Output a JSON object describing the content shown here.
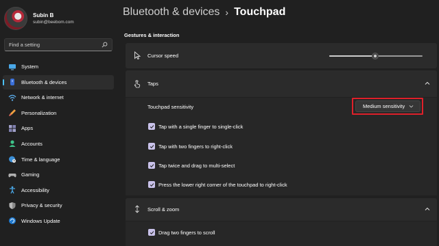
{
  "profile": {
    "name": "Subin B",
    "email": "subin@beebom.com"
  },
  "search": {
    "placeholder": "Find a setting"
  },
  "nav": {
    "items": [
      {
        "label": "System",
        "icon": "monitor-icon"
      },
      {
        "label": "Bluetooth & devices",
        "icon": "bluetooth-icon",
        "active": true
      },
      {
        "label": "Network & internet",
        "icon": "wifi-icon"
      },
      {
        "label": "Personalization",
        "icon": "brush-icon"
      },
      {
        "label": "Apps",
        "icon": "apps-icon"
      },
      {
        "label": "Accounts",
        "icon": "person-icon"
      },
      {
        "label": "Time & language",
        "icon": "globe-clock-icon"
      },
      {
        "label": "Gaming",
        "icon": "gamepad-icon"
      },
      {
        "label": "Accessibility",
        "icon": "accessibility-icon"
      },
      {
        "label": "Privacy & security",
        "icon": "shield-icon"
      },
      {
        "label": "Windows Update",
        "icon": "update-icon"
      }
    ]
  },
  "header": {
    "parent": "Bluetooth & devices",
    "separator": "›",
    "current": "Touchpad"
  },
  "section": {
    "title": "Gestures & interaction"
  },
  "cursor_speed": {
    "label": "Cursor speed",
    "icon": "cursor-icon",
    "value_fraction": 0.49
  },
  "taps": {
    "label": "Taps",
    "icon": "tap-hand-icon",
    "sensitivity_label": "Touchpad sensitivity",
    "sensitivity_value": "Medium sensitivity",
    "options": [
      {
        "label": "Tap with a single finger to single-click",
        "checked": true
      },
      {
        "label": "Tap with two fingers to right-click",
        "checked": true
      },
      {
        "label": "Tap twice and drag to multi-select",
        "checked": true
      },
      {
        "label": "Press the lower right corner of the touchpad to right-click",
        "checked": true
      }
    ]
  },
  "scroll_zoom": {
    "label": "Scroll & zoom",
    "icon": "scroll-arrows-icon",
    "options": [
      {
        "label": "Drag two fingers to scroll",
        "checked": true
      }
    ]
  },
  "colors": {
    "accent": "#4cc2ff",
    "checkbox": "#c9c2ea",
    "highlight": "#e0202a",
    "background": "#202020",
    "card": "#2b2b2b"
  }
}
